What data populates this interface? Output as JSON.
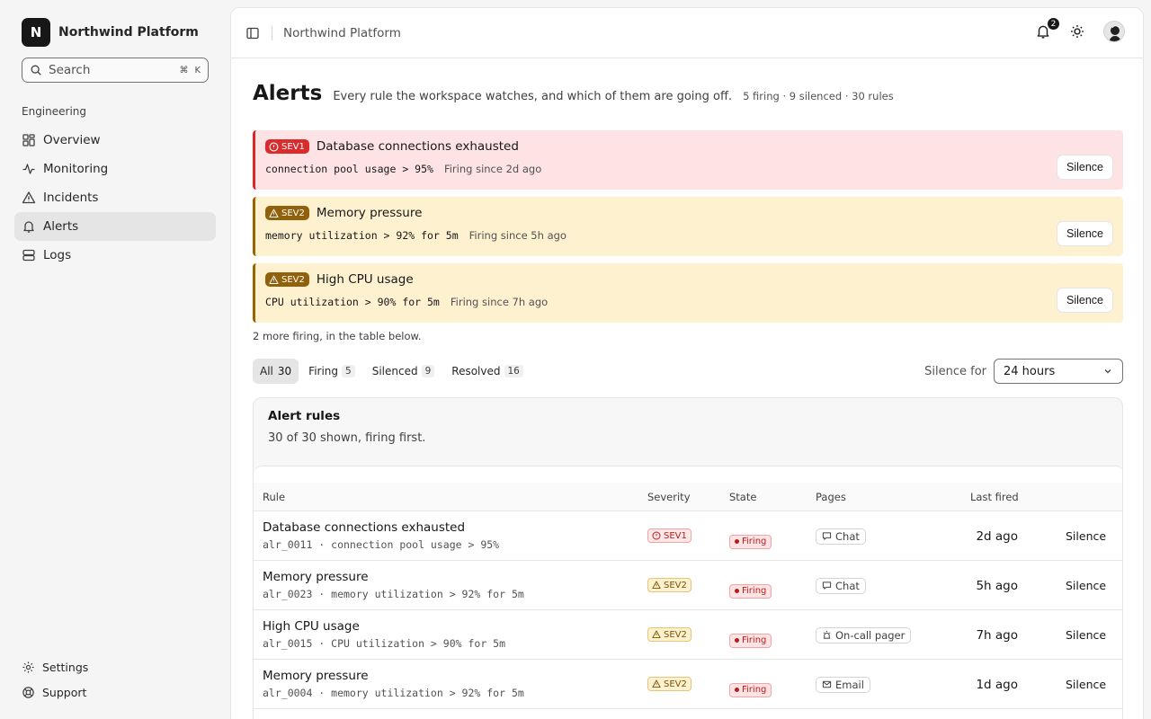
{
  "app": {
    "logo_letter": "N",
    "name": "Northwind Platform"
  },
  "search": {
    "placeholder": "Search",
    "shortcut_cmd": "⌘",
    "shortcut_key": "K"
  },
  "sidebar": {
    "section": "Engineering",
    "items": [
      {
        "label": "Overview",
        "icon": "grid-icon",
        "active": false
      },
      {
        "label": "Monitoring",
        "icon": "activity-icon",
        "active": false
      },
      {
        "label": "Incidents",
        "icon": "warning-triangle-icon",
        "active": false
      },
      {
        "label": "Alerts",
        "icon": "bell-icon",
        "active": true
      },
      {
        "label": "Logs",
        "icon": "server-icon",
        "active": false
      }
    ],
    "footer": [
      {
        "label": "Settings",
        "icon": "gear-icon"
      },
      {
        "label": "Support",
        "icon": "lifebuoy-icon"
      }
    ]
  },
  "topbar": {
    "breadcrumb": "Northwind Platform",
    "notification_count": "2"
  },
  "page": {
    "title": "Alerts",
    "description": "Every rule the workspace watches, and which of them are going off.",
    "stats": "5 firing · 9 silenced · 30 rules"
  },
  "banners": [
    {
      "severity": "SEV1",
      "title": "Database connections exhausted",
      "expr": "connection pool usage > 95%",
      "since": "Firing since 2d ago",
      "action": "Silence"
    },
    {
      "severity": "SEV2",
      "title": "Memory pressure",
      "expr": "memory utilization > 92% for 5m",
      "since": "Firing since 5h ago",
      "action": "Silence"
    },
    {
      "severity": "SEV2",
      "title": "High CPU usage",
      "expr": "CPU utilization > 90% for 5m",
      "since": "Firing since 7h ago",
      "action": "Silence"
    }
  ],
  "more_note": "2 more firing, in the table below.",
  "tabs": [
    {
      "label": "All",
      "count": "30",
      "active": true
    },
    {
      "label": "Firing",
      "count": "5",
      "active": false
    },
    {
      "label": "Silenced",
      "count": "9",
      "active": false
    },
    {
      "label": "Resolved",
      "count": "16",
      "active": false
    }
  ],
  "silence_for": {
    "label": "Silence for",
    "value": "24 hours"
  },
  "table": {
    "title": "Alert rules",
    "subtitle": "30 of 30 shown, firing first.",
    "headers": {
      "rule": "Rule",
      "severity": "Severity",
      "state": "State",
      "pages": "Pages",
      "last_fired": "Last fired"
    },
    "rows": [
      {
        "name": "Database connections exhausted",
        "meta": "alr_0011 · connection pool usage > 95%",
        "severity": "SEV1",
        "state": "Firing",
        "pages": "Chat",
        "pages_icon": "chat-icon",
        "last_fired": "2d ago",
        "action": "Silence"
      },
      {
        "name": "Memory pressure",
        "meta": "alr_0023 · memory utilization > 92% for 5m",
        "severity": "SEV2",
        "state": "Firing",
        "pages": "Chat",
        "pages_icon": "chat-icon",
        "last_fired": "5h ago",
        "action": "Silence"
      },
      {
        "name": "High CPU usage",
        "meta": "alr_0015 · CPU utilization > 90% for 5m",
        "severity": "SEV2",
        "state": "Firing",
        "pages": "On-call pager",
        "pages_icon": "siren-icon",
        "last_fired": "7h ago",
        "action": "Silence"
      },
      {
        "name": "Memory pressure",
        "meta": "alr_0004 · memory utilization > 92% for 5m",
        "severity": "SEV2",
        "state": "Firing",
        "pages": "Email",
        "pages_icon": "mail-icon",
        "last_fired": "1d ago",
        "action": "Silence"
      }
    ]
  }
}
